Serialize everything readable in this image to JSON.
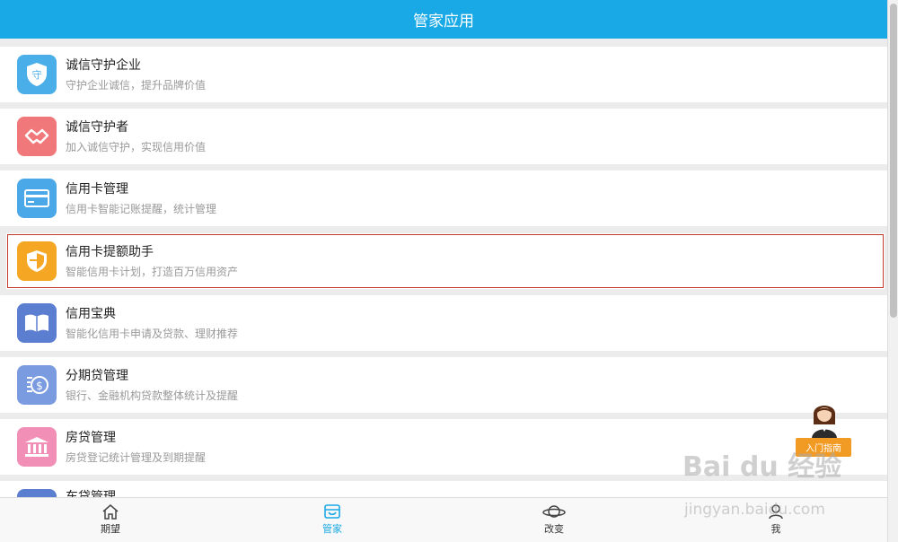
{
  "header": {
    "title": "管家应用"
  },
  "items": [
    {
      "title": "诚信守护企业",
      "subtitle": "守护企业诚信，提升品牌价值",
      "icon": "shield-guard-icon",
      "color": "#4aaee9"
    },
    {
      "title": "诚信守护者",
      "subtitle": "加入诚信守护，实现信用价值",
      "icon": "handshake-icon",
      "color": "#f0787a"
    },
    {
      "title": "信用卡管理",
      "subtitle": "信用卡智能记账提醒，统计管理",
      "icon": "credit-card-icon",
      "color": "#4aa8e8"
    },
    {
      "title": "信用卡提额助手",
      "subtitle": "智能信用卡计划，打造百万信用资产",
      "icon": "shield-icon",
      "color": "#f5a623"
    },
    {
      "title": "信用宝典",
      "subtitle": "智能化信用卡申请及贷款、理财推荐",
      "icon": "book-icon",
      "color": "#5c7ed1"
    },
    {
      "title": "分期贷管理",
      "subtitle": "银行、金融机构贷款整体统计及提醒",
      "icon": "coins-icon",
      "color": "#7a9be0"
    },
    {
      "title": "房贷管理",
      "subtitle": "房贷登记统计管理及到期提醒",
      "icon": "bank-icon",
      "color": "#f28fb6"
    },
    {
      "title": "车贷管理",
      "subtitle": "",
      "icon": "car-icon",
      "color": "#5c7ed1"
    }
  ],
  "tabs": [
    {
      "label": "期望",
      "icon": "home-icon"
    },
    {
      "label": "管家",
      "icon": "basket-icon"
    },
    {
      "label": "改变",
      "icon": "planet-icon"
    },
    {
      "label": "我",
      "icon": "person-icon"
    }
  ],
  "guide": {
    "label": "入门指南"
  },
  "watermark": {
    "text": "Bai du 经验",
    "url_text": "jingyan.baidu.com"
  },
  "colors": {
    "accent": "#19a9e6",
    "selected_border": "#c0392b",
    "guide": "#f29b24"
  }
}
